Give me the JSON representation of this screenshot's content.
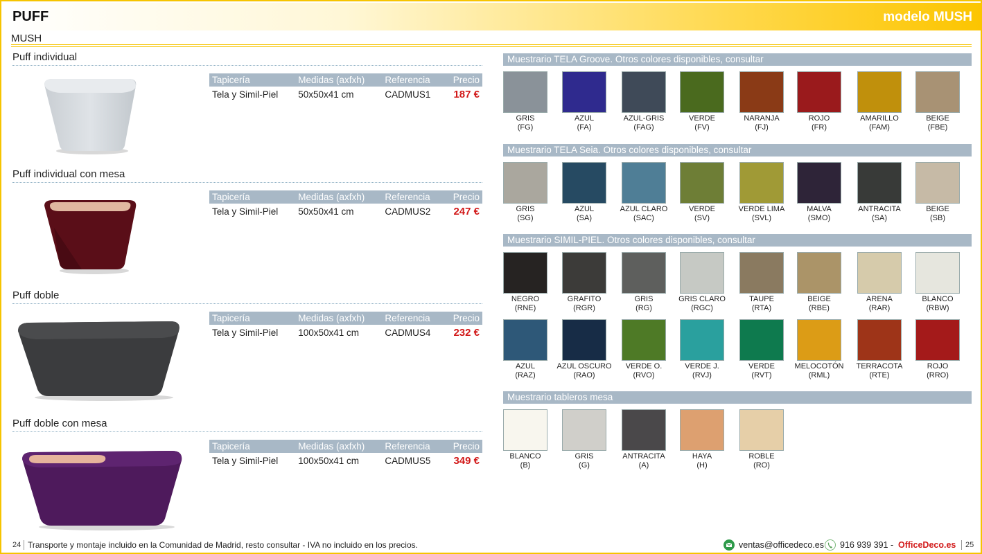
{
  "header": {
    "title": "PUFF",
    "model": "modelo MUSH"
  },
  "subtitle": "MUSH",
  "table_headers": {
    "tapiceria": "Tapicería",
    "medidas": "Medidas (axfxh)",
    "referencia": "Referencia",
    "precio": "Precio"
  },
  "products": [
    {
      "name": "Puff individual",
      "tapiceria": "Tela y Simil-Piel",
      "medidas": "50x50x41 cm",
      "referencia": "CADMUS1",
      "precio": "187 €"
    },
    {
      "name": "Puff individual con mesa",
      "tapiceria": "Tela y Simil-Piel",
      "medidas": "50x50x41 cm",
      "referencia": "CADMUS2",
      "precio": "247 €"
    },
    {
      "name": "Puff doble",
      "tapiceria": "Tela y Simil-Piel",
      "medidas": "100x50x41 cm",
      "referencia": "CADMUS4",
      "precio": "232 €"
    },
    {
      "name": "Puff doble con mesa",
      "tapiceria": "Tela y Simil-Piel",
      "medidas": "100x50x41 cm",
      "referencia": "CADMUS5",
      "precio": "349 €"
    }
  ],
  "swatch_sections": [
    {
      "title": "Muestrario TELA Groove. Otros colores disponibles, consultar",
      "items": [
        {
          "name": "GRIS",
          "code": "(FG)",
          "color": "#8a9299"
        },
        {
          "name": "AZUL",
          "code": "(FA)",
          "color": "#2f2a8e"
        },
        {
          "name": "AZUL-GRIS",
          "code": "(FAG)",
          "color": "#3f4a58"
        },
        {
          "name": "VERDE",
          "code": "(FV)",
          "color": "#4a6a1e"
        },
        {
          "name": "NARANJA",
          "code": "(FJ)",
          "color": "#8a3a16"
        },
        {
          "name": "ROJO",
          "code": "(FR)",
          "color": "#9a1a1c"
        },
        {
          "name": "AMARILLO",
          "code": "(FAM)",
          "color": "#c0900c"
        },
        {
          "name": "BEIGE",
          "code": "(FBE)",
          "color": "#a89274"
        }
      ]
    },
    {
      "title": "Muestrario TELA Seia. Otros colores disponibles, consultar",
      "items": [
        {
          "name": "GRIS",
          "code": "(SG)",
          "color": "#aaa79e"
        },
        {
          "name": "AZUL",
          "code": "(SA)",
          "color": "#264a62"
        },
        {
          "name": "AZUL CLARO",
          "code": "(SAC)",
          "color": "#4f7e96"
        },
        {
          "name": "VERDE",
          "code": "(SV)",
          "color": "#6e7e36"
        },
        {
          "name": "VERDE LIMA",
          "code": "(SVL)",
          "color": "#a09a36"
        },
        {
          "name": "MALVA",
          "code": "(SMO)",
          "color": "#2e2438"
        },
        {
          "name": "ANTRACITA",
          "code": "(SA)",
          "color": "#383a38"
        },
        {
          "name": "BEIGE",
          "code": "(SB)",
          "color": "#c6baa6"
        }
      ]
    },
    {
      "title": "Muestrario SIMIL-PIEL. Otros colores disponibles, consultar",
      "items": [
        {
          "name": "NEGRO",
          "code": "(RNE)",
          "color": "#262322"
        },
        {
          "name": "GRAFITO",
          "code": "(RGR)",
          "color": "#3c3b39"
        },
        {
          "name": "GRIS",
          "code": "(RG)",
          "color": "#5e5f5d"
        },
        {
          "name": "GRIS CLARO",
          "code": "(RGC)",
          "color": "#c6c9c4"
        },
        {
          "name": "TAUPE",
          "code": "(RTA)",
          "color": "#8a7a60"
        },
        {
          "name": "BEIGE",
          "code": "(RBE)",
          "color": "#ab9468"
        },
        {
          "name": "ARENA",
          "code": "(RAR)",
          "color": "#d6cbab"
        },
        {
          "name": "BLANCO",
          "code": "(RBW)",
          "color": "#e6e6de"
        },
        {
          "name": "AZUL",
          "code": "(RAZ)",
          "color": "#2e5878"
        },
        {
          "name": "AZUL OSCURO",
          "code": "(RAO)",
          "color": "#172c46"
        },
        {
          "name": "VERDE O.",
          "code": "(RVO)",
          "color": "#4e7a26"
        },
        {
          "name": "VERDE J.",
          "code": "(RVJ)",
          "color": "#2aa09e"
        },
        {
          "name": "VERDE",
          "code": "(RVT)",
          "color": "#0e7a4e"
        },
        {
          "name": "MELOCOTÓN",
          "code": "(RML)",
          "color": "#dc9c16"
        },
        {
          "name": "TERRACOTA",
          "code": "(RTE)",
          "color": "#9e3418"
        },
        {
          "name": "ROJO",
          "code": "(RRO)",
          "color": "#a41a1a"
        }
      ]
    },
    {
      "title": "Muestrario tableros mesa",
      "items": [
        {
          "name": "BLANCO",
          "code": "(B)",
          "color": "#f8f6ee"
        },
        {
          "name": "GRIS",
          "code": "(G)",
          "color": "#d0cfca"
        },
        {
          "name": "ANTRACITA",
          "code": "(A)",
          "color": "#4a484a"
        },
        {
          "name": "HAYA",
          "code": "(H)",
          "color": "#dda070"
        },
        {
          "name": "ROBLE",
          "code": "(RO)",
          "color": "#e6cfa8"
        }
      ]
    }
  ],
  "footer": {
    "page_left": "24",
    "note": "Transporte y montaje incluido en la Comunidad de Madrid, resto consultar - IVA no incluido en los precios.",
    "email": "ventas@officedeco.es",
    "phone": "916 939 391",
    "dash": "-",
    "brand": "OfficeDeco.es",
    "page_right": "25"
  }
}
